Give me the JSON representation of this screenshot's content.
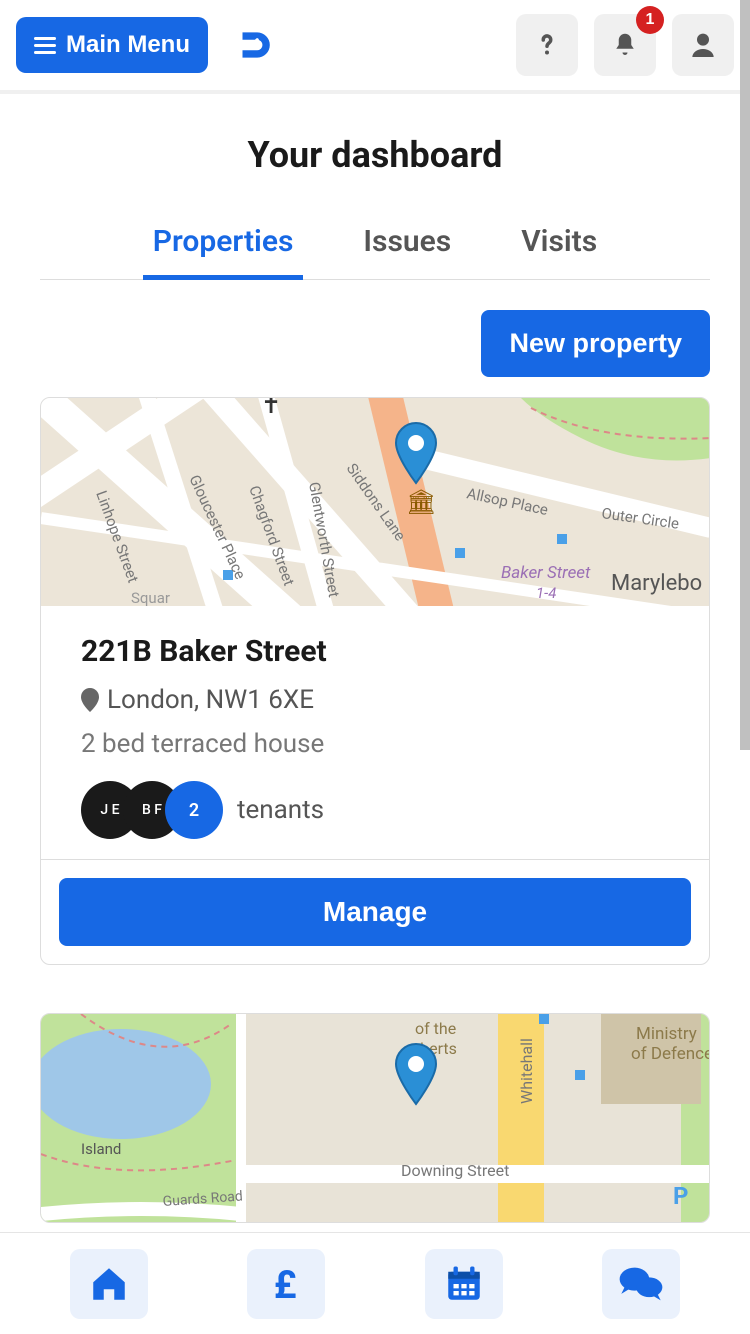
{
  "header": {
    "menu_label": "Main Menu",
    "notifications_count": "1"
  },
  "dashboard": {
    "title": "Your dashboard"
  },
  "tabs": {
    "properties": "Properties",
    "issues": "Issues",
    "visits": "Visits"
  },
  "actions": {
    "new_property": "New property",
    "manage": "Manage"
  },
  "properties": [
    {
      "name": "221B Baker Street",
      "location": "London, NW1 6XE",
      "description": "2 bed terraced house",
      "tenant_avatars": [
        "J E",
        "B F"
      ],
      "tenant_extra": "2",
      "tenants_label": "tenants"
    }
  ],
  "map_labels": {
    "p0": {
      "linhope": "Linhope Street",
      "gloucester": "Gloucester Place",
      "chagford": "Chagford Street",
      "glentworth": "Glentworth Street",
      "siddons": "Siddons Lane",
      "allsop": "Allsop Place",
      "outer": "Outer Circle",
      "baker": "Baker Street",
      "baker_num": "1-4",
      "marylebone": "Marylebo",
      "square": "Squar"
    },
    "p1": {
      "whitehall": "Whitehall",
      "downing": "Downing Street",
      "guards": "Guards Road",
      "island": "Island",
      "ministry": "Ministry",
      "defence": "of Defence",
      "ofthe": "of the",
      "oberts": "oberts"
    }
  },
  "colors": {
    "primary": "#1768e4"
  }
}
